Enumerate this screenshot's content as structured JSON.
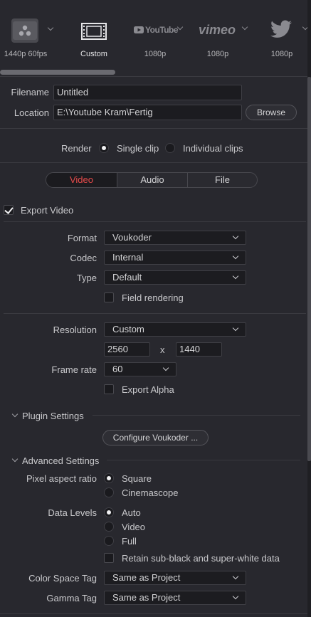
{
  "presets": [
    {
      "label": "1440p 60fps",
      "icon": "resolve-logo-icon"
    },
    {
      "label": "Custom",
      "icon": "film-strip-icon",
      "selected": true
    },
    {
      "label": "1080p",
      "icon": "youtube-logo-icon",
      "logo_text": "YouTube"
    },
    {
      "label": "1080p",
      "icon": "vimeo-logo-icon",
      "logo_text": "vimeo"
    },
    {
      "label": "1080p",
      "icon": "twitter-logo-icon"
    }
  ],
  "file": {
    "filename_label": "Filename",
    "filename_value": "Untitled",
    "location_label": "Location",
    "location_value": "E:\\Youtube Kram\\Fertig",
    "browse_label": "Browse"
  },
  "render": {
    "label": "Render",
    "single_clip": "Single clip",
    "individual_clips": "Individual clips",
    "selected": "single_clip"
  },
  "tabs": [
    "Video",
    "Audio",
    "File"
  ],
  "active_tab": "Video",
  "export_video": {
    "label": "Export Video",
    "checked": true
  },
  "format": {
    "label": "Format",
    "value": "Voukoder"
  },
  "codec": {
    "label": "Codec",
    "value": "Internal"
  },
  "type": {
    "label": "Type",
    "value": "Default"
  },
  "field_rendering": {
    "label": "Field rendering",
    "checked": false
  },
  "resolution": {
    "label": "Resolution",
    "value": "Custom",
    "width": "2560",
    "x_sep": "x",
    "height": "1440"
  },
  "frame_rate": {
    "label": "Frame rate",
    "value": "60"
  },
  "export_alpha": {
    "label": "Export Alpha",
    "checked": false
  },
  "plugin_settings": {
    "label": "Plugin Settings",
    "button": "Configure Voukoder ..."
  },
  "advanced_settings": {
    "label": "Advanced Settings",
    "pixel_aspect_label": "Pixel aspect ratio",
    "pixel_aspect_options": [
      "Square",
      "Cinemascope"
    ],
    "pixel_aspect_selected": "Square",
    "data_levels_label": "Data Levels",
    "data_levels_options": [
      "Auto",
      "Video",
      "Full"
    ],
    "data_levels_selected": "Auto",
    "retain_label": "Retain sub-black and super-white data",
    "retain_checked": false,
    "color_space_label": "Color Space Tag",
    "color_space_value": "Same as Project",
    "gamma_label": "Gamma Tag",
    "gamma_value": "Same as Project"
  },
  "colors": {
    "accent": "#e64b4b",
    "background": "#28282e",
    "field": "#1c1c20"
  }
}
